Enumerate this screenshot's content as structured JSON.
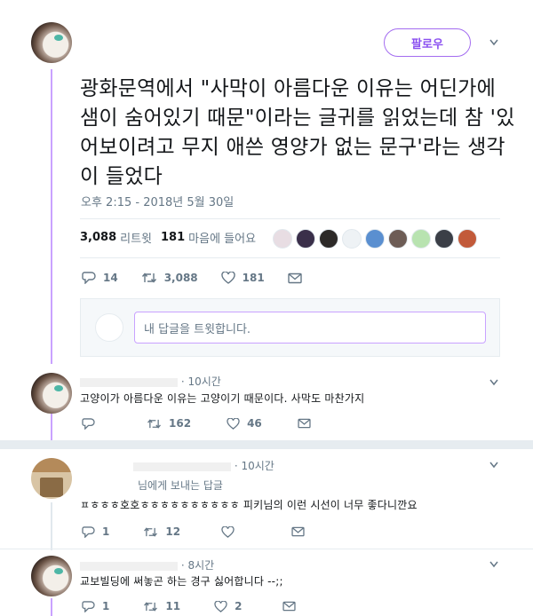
{
  "main_tweet": {
    "follow_label": "팔로우",
    "text": "광화문역에서 \"사막이 아름다운 이유는 어딘가에 샘이 숨어있기 때문\"이라는 글귀를 읽었는데 참 '있어보이려고 무지 애쓴 영양가 없는 문구'라는 생각이 들었다",
    "timestamp": "오후 2:15 - 2018년 5월 30일",
    "retweet_count": "3,088",
    "retweet_label": "리트윗",
    "like_count": "181",
    "like_label": "마음에 들어요",
    "actions": {
      "reply": "14",
      "retweet": "3,088",
      "like": "181"
    },
    "liker_avatar_colors": [
      "#e8dde3",
      "#3a2f4a",
      "#2d2a28",
      "#eef2f5",
      "#5a8fd0",
      "#6d5c55",
      "#b8e3b0",
      "#3b3f47",
      "#c25a3a"
    ]
  },
  "reply_box": {
    "placeholder": "내 답글을 트윗합니다."
  },
  "replies": [
    {
      "time": "· 10시간",
      "text": "고양이가 아름다운 이유는 고양이기 때문이다. 사막도 마찬가지",
      "actions": {
        "reply": "",
        "retweet": "162",
        "like": "46"
      }
    },
    {
      "time": "· 10시간",
      "reply_to": "님에게 보내는 답글",
      "text": "ㅍㅎㅎㅎ호호ㅎㅎㅎㅎㅎㅎㅎㅎㅎㅎ 피키님의 이런 시선이 너무 좋다니깐요",
      "actions": {
        "reply": "1",
        "retweet": "12",
        "like": ""
      }
    },
    {
      "time": "· 8시간",
      "text": "교보빌딩에 써놓곤 하는 경구 싫어합니다 --;;",
      "actions": {
        "reply": "1",
        "retweet": "11",
        "like": "2"
      }
    }
  ],
  "icons": [
    "reply-icon",
    "retweet-icon",
    "like-icon",
    "message-icon",
    "chevron-down-icon"
  ],
  "colors": {
    "accent": "#8a4ff0",
    "thread_line": "#c9a2ff",
    "muted": "#657786"
  }
}
